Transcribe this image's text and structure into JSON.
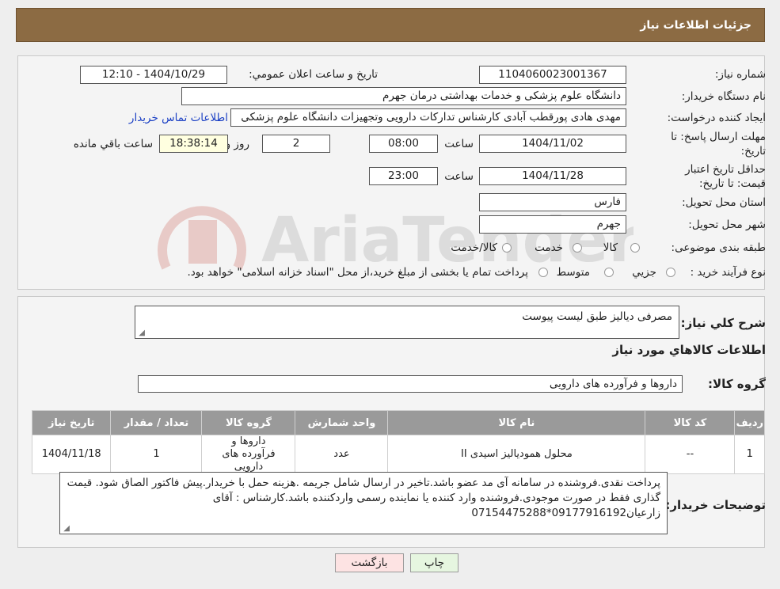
{
  "header": {
    "title": "جزئیات اطلاعات نیاز"
  },
  "form": {
    "need_number_label": "شماره نیاز:",
    "need_number": "1104060023001367",
    "announce_label": "تاریخ و ساعت اعلان عمومي:",
    "announce_value": "1404/10/29 - 12:10",
    "buyer_org_label": "نام دستگاه خریدار:",
    "buyer_org": "دانشگاه علوم پزشکی و خدمات بهداشتی  درمان جهرم",
    "creator_label": "ایجاد کننده درخواست:",
    "creator": "مهدی هادی پورقطب آبادی کارشناس تدارکات دارویی وتجهیزات دانشگاه علوم پزشکی",
    "contact_link": "اطلاعات تماس خریدار",
    "deadline_label": "مهلت ارسال پاسخ: تا تاریخ:",
    "deadline_date": "1404/11/02",
    "time_label": "ساعت",
    "deadline_time": "08:00",
    "days_value": "2",
    "days_label": "روز و",
    "remaining_value": "18:38:14",
    "remaining_label": "ساعت باقي مانده",
    "validity_label": "حداقل تاریخ اعتبار قیمت: تا تاریخ:",
    "validity_date": "1404/11/28",
    "validity_time": "23:00",
    "province_label": "استان محل تحویل:",
    "province": "فارس",
    "city_label": "شهر محل تحویل:",
    "city": "جهرم",
    "category_label": "طبقه بندی موضوعی:",
    "category_options": [
      "کالا",
      "خدمت",
      "کالا/خدمت"
    ],
    "process_label": "نوع فرآیند خرید :",
    "process_options": [
      "جزیي",
      "متوسط"
    ],
    "process_note": "پرداخت تمام یا بخشی از مبلغ خرید،از محل \"اسناد خزانه اسلامی\" خواهد بود."
  },
  "description": {
    "label": "شرح كلي نیاز:",
    "value": "مصرفی دیالیز طبق لیست پیوست",
    "items_title": "اطلاعات كالاهاي مورد نیاز",
    "group_label": "گروه كالا:",
    "group_value": "داروها و فرآورده های دارویی"
  },
  "table": {
    "headers": [
      "ردیف",
      "كد كالا",
      "نام كالا",
      "واحد شمارش",
      "گروه كالا",
      "تعداد / مقدار",
      "تاریخ نیاز"
    ],
    "rows": [
      [
        "1",
        "--",
        "محلول همودیالیز اسیدی II",
        "عدد",
        "داروها و فرآورده های دارویی",
        "1",
        "1404/11/18"
      ]
    ]
  },
  "notes": {
    "label": "توضیحات خریدار:",
    "value": "پرداخت نقدی.فروشنده در سامانه آی مد عضو باشد.تاخیر در ارسال شامل جریمه .هزینه حمل با خریدار.پیش فاکتور الصاق شود. قیمت گذاری فقط در صورت موجودی.فروشنده وارد کننده یا نماینده رسمی واردکننده باشد.کارشناس : آقای زارعیان09177916192*07154475288"
  },
  "buttons": {
    "print": "چاپ",
    "back": "بازگشت"
  },
  "watermark": {
    "text": "AriaTender.neT"
  },
  "colors": {
    "header_bg": "#8c6b43",
    "table_header_bg": "#9a9a9a",
    "back_button_bg": "#fde3e3",
    "print_button_bg": "#e6f6e0"
  }
}
